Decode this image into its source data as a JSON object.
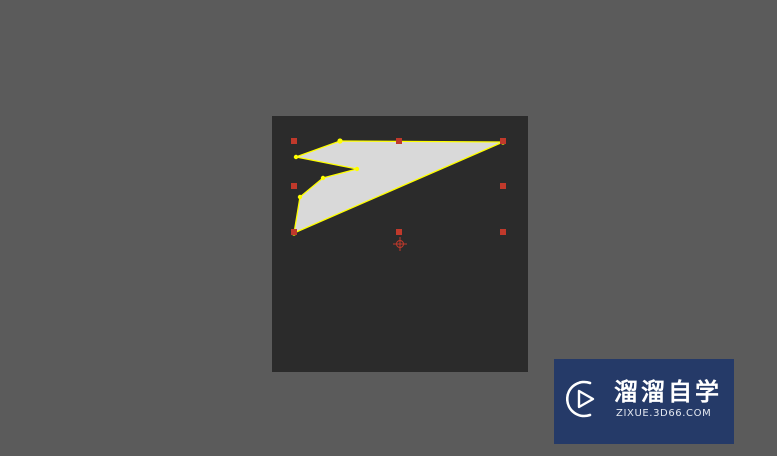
{
  "workspace": {
    "background": "#5b5b5b",
    "artboard_color": "#2b2b2b"
  },
  "selection": {
    "shape_fill": "#d9d9d9",
    "path_stroke": "#ffff00",
    "handle_color": "#c0392b",
    "pivot_icon": "crosshair-icon"
  },
  "watermark": {
    "title": "溜溜自学",
    "url": "ZIXUE.3D66.COM",
    "background": "#253a68",
    "logo_icon": "play-logo-icon"
  }
}
